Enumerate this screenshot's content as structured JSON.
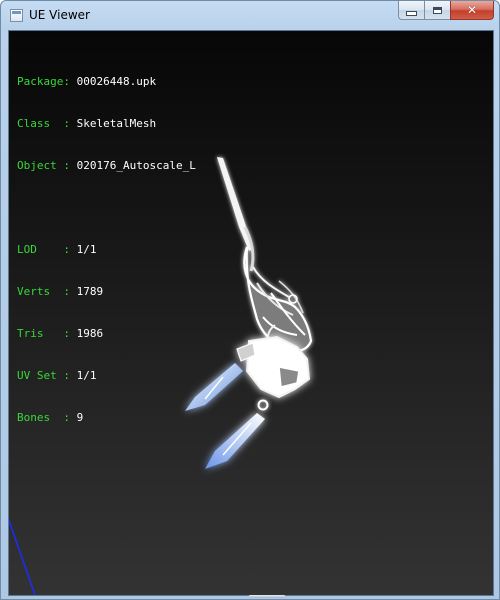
{
  "window": {
    "title": "UE Viewer",
    "icon": "app-window-icon",
    "buttons": {
      "minimize_icon": "minimize-icon",
      "maximize_icon": "maximize-icon",
      "close_icon": "close-icon",
      "close_glyph": "✕"
    }
  },
  "info": {
    "package": {
      "label": "Package",
      "sep": ": ",
      "value": "00026448.upk"
    },
    "class": {
      "label": "Class  ",
      "sep": ": ",
      "value": "SkeletalMesh"
    },
    "object": {
      "label": "Object ",
      "sep": ": ",
      "value": "020176_Autoscale_L"
    },
    "lod": {
      "label": "LOD    ",
      "sep": ": ",
      "value": "1/1"
    },
    "verts": {
      "label": "Verts  ",
      "sep": ": ",
      "value": "1789"
    },
    "tris": {
      "label": "Tris   ",
      "sep": ": ",
      "value": "1986"
    },
    "uvset": {
      "label": "UV Set ",
      "sep": ": ",
      "value": "1/1"
    },
    "bones": {
      "label": "Bones  ",
      "sep": ": ",
      "value": "9"
    }
  },
  "colors": {
    "label_green": "#38d838",
    "value_white": "#ffffff",
    "axis_blue": "#1a2cff"
  }
}
